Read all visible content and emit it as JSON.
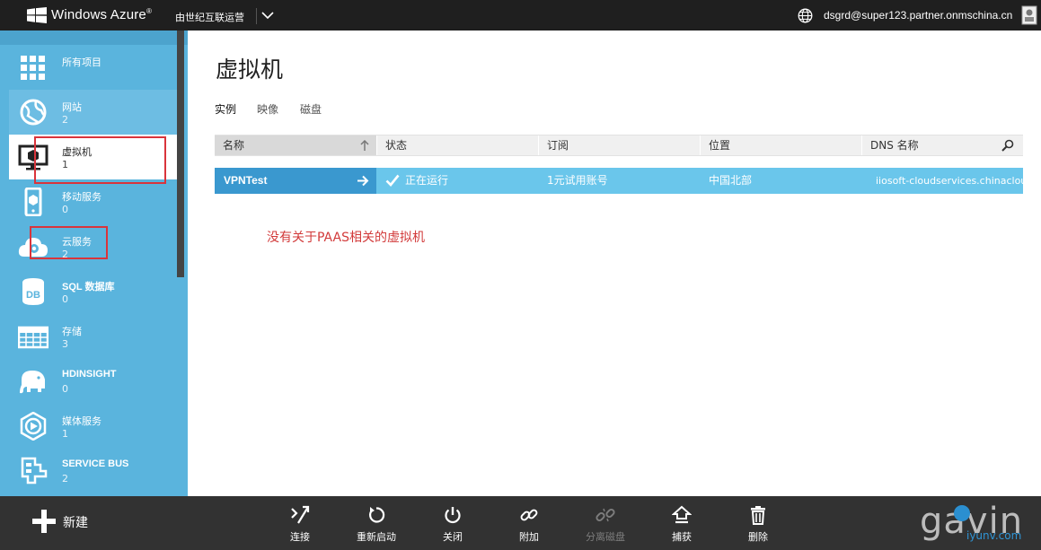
{
  "topbar": {
    "brand": "Windows Azure",
    "brand_mark": "®",
    "operator": "由世纪互联运营",
    "account": "dsgrd@super123.partner.onmschina.cn"
  },
  "sidebar": {
    "items": [
      {
        "label": "所有项目",
        "count": "",
        "icon": "all-items-grid-icon"
      },
      {
        "label": "网站",
        "count": "2",
        "icon": "website-globe-icon"
      },
      {
        "label": "虚拟机",
        "count": "1",
        "icon": "virtual-machine-monitor-icon"
      },
      {
        "label": "移动服务",
        "count": "0",
        "icon": "mobile-phone-icon"
      },
      {
        "label": "云服务",
        "count": "2",
        "icon": "cloud-gear-icon"
      },
      {
        "label": "SQL 数据库",
        "count": "0",
        "icon": "database-db-icon"
      },
      {
        "label": "存储",
        "count": "3",
        "icon": "storage-table-icon"
      },
      {
        "label": "HDINSIGHT",
        "count": "0",
        "icon": "elephant-icon"
      },
      {
        "label": "媒体服务",
        "count": "1",
        "icon": "media-play-icon"
      },
      {
        "label": "SERVICE BUS",
        "count": "2",
        "icon": "service-bus-icon"
      }
    ],
    "selected_index": 2
  },
  "main": {
    "title": "虚拟机",
    "tabs": [
      {
        "label": "实例",
        "active": true
      },
      {
        "label": "映像",
        "active": false
      },
      {
        "label": "磁盘",
        "active": false
      }
    ],
    "columns": [
      "名称",
      "状态",
      "订阅",
      "位置",
      "DNS 名称"
    ],
    "rows": [
      {
        "name": "VPNTest",
        "status": "正在运行",
        "subscription": "1元试用账号",
        "location": "中国北部",
        "dns": "iiosoft-cloudservices.chinacloudapp.cn"
      }
    ],
    "annotation": "没有关于PAAS相关的虚拟机"
  },
  "cmdbar": {
    "new_label": "新建",
    "commands": [
      {
        "label": "连接",
        "icon": "connect-icon",
        "enabled": true
      },
      {
        "label": "重新启动",
        "icon": "restart-icon",
        "enabled": true
      },
      {
        "label": "关闭",
        "icon": "power-icon",
        "enabled": true
      },
      {
        "label": "附加",
        "icon": "attach-link-icon",
        "enabled": true
      },
      {
        "label": "分离磁盘",
        "icon": "detach-link-icon",
        "enabled": false
      },
      {
        "label": "捕获",
        "icon": "capture-icon",
        "enabled": true
      },
      {
        "label": "删除",
        "icon": "delete-trash-icon",
        "enabled": true
      }
    ]
  },
  "watermark": {
    "text": "gavin",
    "sub": "iyunv.com"
  },
  "colors": {
    "sidebar": "#5ab4dd",
    "selected_row_name": "#3a98cf",
    "selected_row": "#6ac6eb",
    "annotation": "#d23a3a",
    "cmdbar": "#323232"
  }
}
